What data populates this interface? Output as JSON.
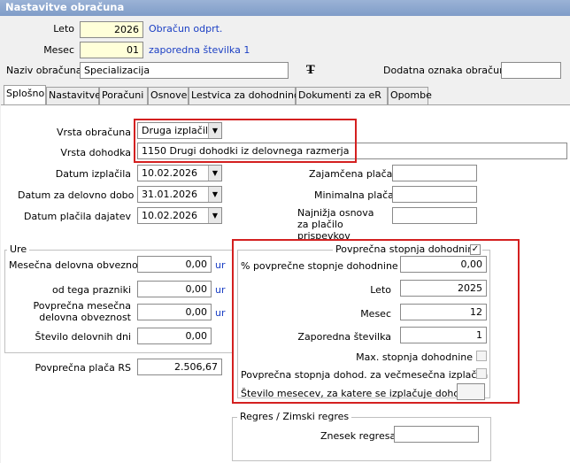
{
  "window": {
    "title": "Nastavitve obračuna"
  },
  "header": {
    "leto_label": "Leto",
    "leto_value": "2026",
    "leto_info": "Obračun odprt.",
    "mesec_label": "Mesec",
    "mesec_value": "01",
    "mesec_info": "zaporedna številka 1",
    "naziv_label": "Naziv obračuna",
    "naziv_value": "Specializacija",
    "dodatna_label": "Dodatna oznaka obračuna",
    "dodatna_value": ""
  },
  "tabs": [
    "Splošno",
    "Nastavitve",
    "Poračuni",
    "Osnove",
    "Lestvica za dohodnino",
    "Dokumenti za eR",
    "Opombe"
  ],
  "form": {
    "vrsta_obracuna_label": "Vrsta obračuna",
    "vrsta_obracuna_value": "Druga izplačila",
    "vrsta_dohodka_label": "Vrsta dohodka",
    "vrsta_dohodka_value": "1150  Drugi dohodki iz delovnega razmerja",
    "datum_izplacila_label": "Datum izplačila",
    "datum_izplacila_value": "10.02.2026",
    "datum_delo_label": "Datum za delovno dobo",
    "datum_delo_value": "31.01.2026",
    "datum_dajatev_label": "Datum plačila dajatev",
    "datum_dajatev_value": "10.02.2026",
    "zajamcena_label": "Zajamčena plača",
    "zajamcena_value": "",
    "minimalna_label": "Minimalna plača",
    "minimalna_value": "",
    "najnizja_label": "Najnižja osnova za plačilo prispevkov",
    "najnizja_value": ""
  },
  "ure": {
    "title": "Ure",
    "unit": "ur",
    "rows": [
      {
        "label": "Mesečna delovna obveznost",
        "value": "0,00",
        "unit": "ur"
      },
      {
        "label": "od tega prazniki",
        "value": "0,00",
        "unit": "ur"
      },
      {
        "label": "Povprečna mesečna delovna obveznost",
        "value": "0,00",
        "unit": "ur"
      },
      {
        "label": "Število delovnih dni",
        "value": "0,00",
        "unit": ""
      }
    ],
    "placa_label": "Povprečna plača RS",
    "placa_value": "2.506,67"
  },
  "dohodnina": {
    "title": "Povprečna stopnja dohodnine",
    "checked": "✓",
    "pct_label": "% povprečne stopnje dohodnine",
    "pct_value": "0,00",
    "leto_label": "Leto",
    "leto_value": "2025",
    "mesec_label": "Mesec",
    "mesec_value": "12",
    "zap_label": "Zaporedna številka",
    "zap_value": "1",
    "max_label": "Max. stopnja dohodnine",
    "vecmesecna_label": "Povprečna stopnja dohod. za večmesečna izplačila",
    "st_mesecev_label": "Število mesecev, za katere se izplačuje dohodek",
    "st_mesecev_value": ""
  },
  "regres": {
    "title": "Regres / Zimski regres",
    "znesek_label": "Znesek regresa",
    "znesek_value": ""
  },
  "colors": {
    "accent_red": "#d42020",
    "info_blue": "#1b3fc4",
    "highlight_yellow": "#ffffd9"
  }
}
